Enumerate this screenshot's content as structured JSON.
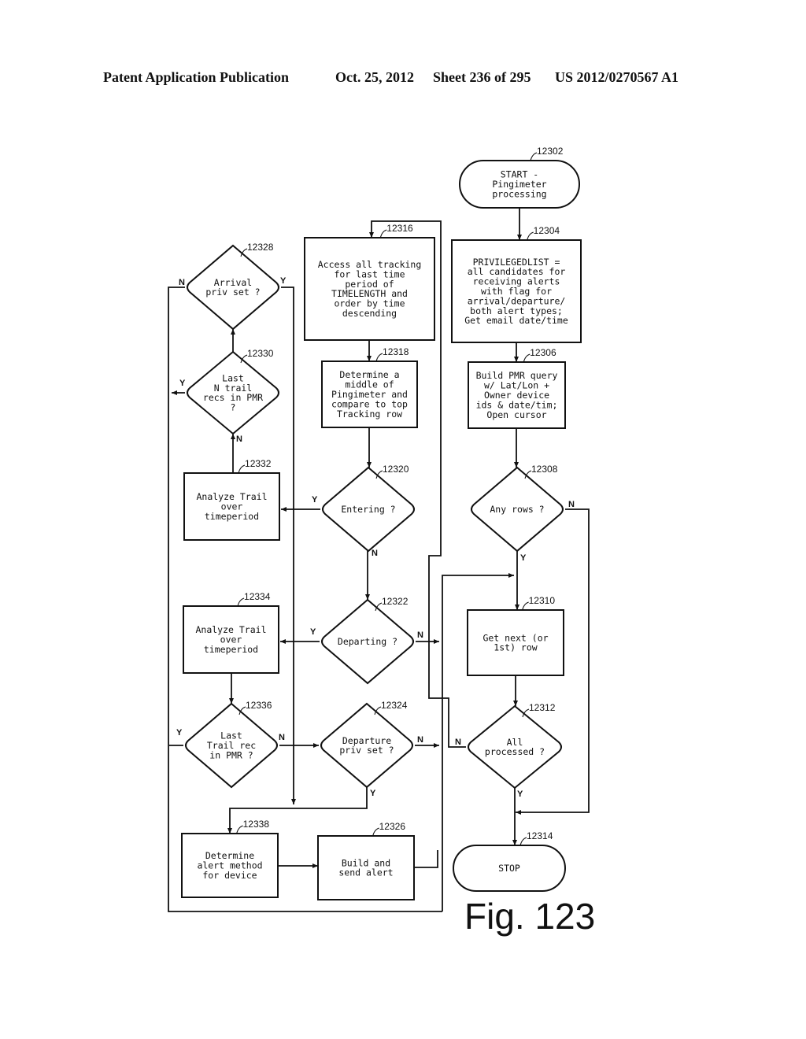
{
  "header": {
    "publication": "Patent Application Publication",
    "date": "Oct. 25, 2012",
    "sheet": "Sheet 236 of 295",
    "patent_number": "US 2012/0270567 A1"
  },
  "figure_label": "Fig. 123",
  "nodes": {
    "n12302": {
      "ref": "12302",
      "type": "terminal",
      "lines": [
        "START -",
        "Pingimeter",
        "processing"
      ]
    },
    "n12304": {
      "ref": "12304",
      "type": "process",
      "lines": [
        "PRIVILEGEDLIST =",
        "all candidates for",
        "receiving alerts",
        "with flag for",
        "arrival/departure/",
        "both alert types;",
        "Get email date/time"
      ]
    },
    "n12306": {
      "ref": "12306",
      "type": "process",
      "lines": [
        "Build PMR query",
        "w/ Lat/Lon +",
        "Owner device",
        "ids & date/tim;",
        "Open cursor"
      ]
    },
    "n12308": {
      "ref": "12308",
      "type": "decision",
      "lines": [
        "Any rows ?"
      ]
    },
    "n12310": {
      "ref": "12310",
      "type": "process",
      "lines": [
        "Get next (or",
        "1st) row"
      ]
    },
    "n12312": {
      "ref": "12312",
      "type": "decision",
      "lines": [
        "All",
        "processed ?"
      ]
    },
    "n12314": {
      "ref": "12314",
      "type": "terminal",
      "lines": [
        "STOP"
      ]
    },
    "n12316": {
      "ref": "12316",
      "type": "process",
      "lines": [
        "Access all tracking",
        "for last time",
        "period of",
        "TIMELENGTH and",
        "order by time",
        "descending"
      ]
    },
    "n12318": {
      "ref": "12318",
      "type": "process",
      "lines": [
        "Determine a",
        "middle of",
        "Pingimeter and",
        "compare to top",
        "Tracking row"
      ]
    },
    "n12320": {
      "ref": "12320",
      "type": "decision",
      "lines": [
        "Entering ?"
      ]
    },
    "n12322": {
      "ref": "12322",
      "type": "decision",
      "lines": [
        "Departing ?"
      ]
    },
    "n12324": {
      "ref": "12324",
      "type": "decision",
      "lines": [
        "Departure",
        "priv set ?"
      ]
    },
    "n12326": {
      "ref": "12326",
      "type": "process",
      "lines": [
        "Build and",
        "send alert"
      ]
    },
    "n12328": {
      "ref": "12328",
      "type": "decision",
      "lines": [
        "Arrival",
        "priv set ?"
      ]
    },
    "n12330": {
      "ref": "12330",
      "type": "decision",
      "lines": [
        "Last",
        "N trail",
        "recs in PMR",
        "?"
      ]
    },
    "n12332": {
      "ref": "12332",
      "type": "process",
      "lines": [
        "Analyze Trail",
        "over",
        "timeperiod"
      ]
    },
    "n12334": {
      "ref": "12334",
      "type": "process",
      "lines": [
        "Analyze Trail",
        "over",
        "timeperiod"
      ]
    },
    "n12336": {
      "ref": "12336",
      "type": "decision",
      "lines": [
        "Last",
        "Trail rec",
        "in PMR ?"
      ]
    },
    "n12338": {
      "ref": "12338",
      "type": "process",
      "lines": [
        "Determine",
        "alert method",
        "for device"
      ]
    }
  },
  "branch_labels": {
    "yes": "Y",
    "no": "N"
  }
}
